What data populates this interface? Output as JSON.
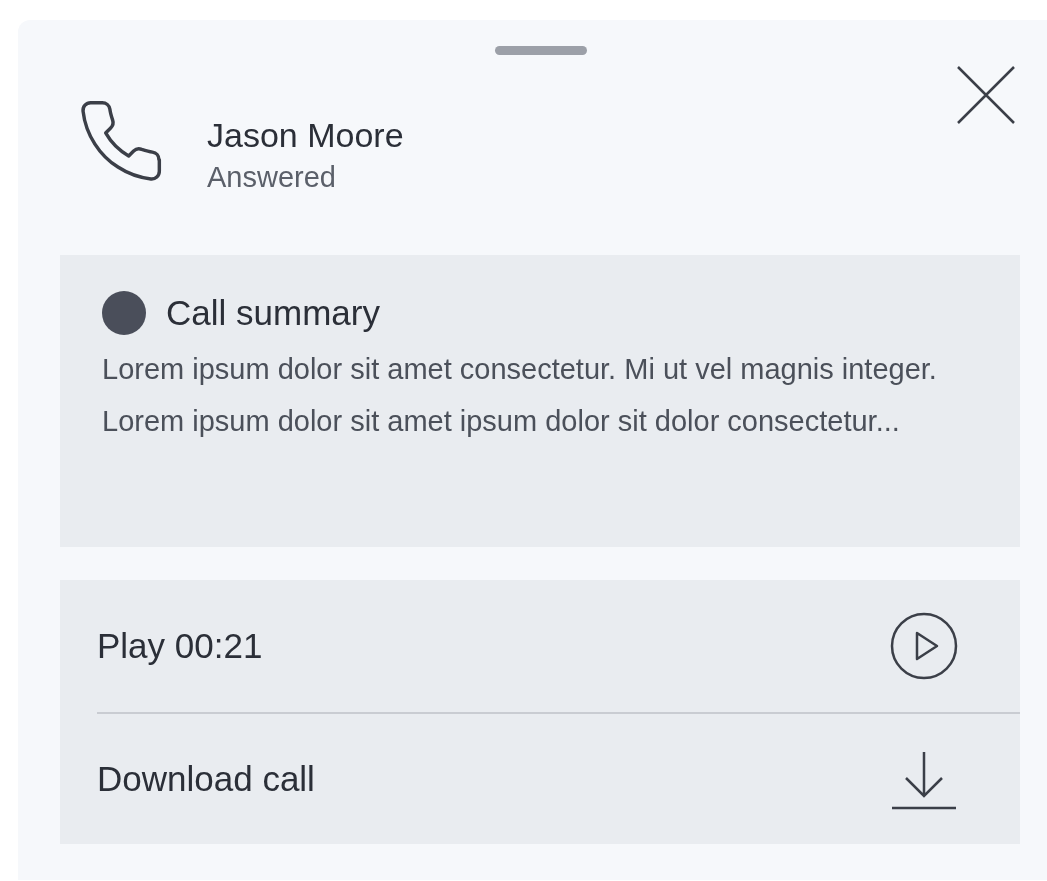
{
  "contact": {
    "name": "Jason Moore",
    "status": "Answered"
  },
  "summary": {
    "title": "Call summary",
    "body": "Lorem ipsum dolor sit amet consectetur. Mi ut vel magnis integer. Lorem ipsum dolor sit amet ipsum dolor sit dolor consectetur..."
  },
  "actions": [
    {
      "label": "Play 00:21",
      "kind": "play"
    },
    {
      "label": "Download call",
      "kind": "download"
    }
  ]
}
